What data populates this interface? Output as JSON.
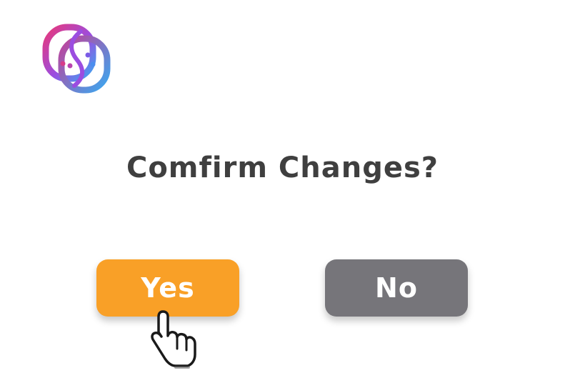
{
  "logo": {
    "icon": "smiley-loop-logo-icon"
  },
  "dialog": {
    "title": "Comfirm Changes?",
    "yes_label": "Yes",
    "no_label": "No"
  },
  "colors": {
    "yes_button": "#f9a027",
    "no_button": "#76757a",
    "title_text": "#3f3f3f",
    "logo_gradient": [
      "#e8387a",
      "#9b4de0",
      "#3aa8f0"
    ]
  },
  "cursor": {
    "icon": "hand-pointer-icon"
  }
}
